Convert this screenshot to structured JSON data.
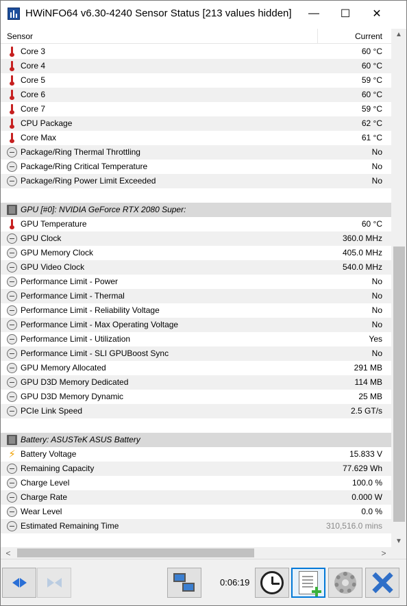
{
  "window": {
    "title": "HWiNFO64 v6.30-4240 Sensor Status [213 values hidden]",
    "minimize_glyph": "—",
    "maximize_glyph": "☐",
    "close_glyph": "✕"
  },
  "header": {
    "sensor": "Sensor",
    "current": "Current"
  },
  "rows": [
    {
      "type": "item",
      "icon": "thermometer-icon",
      "label": "Core 3",
      "value": "60 °C"
    },
    {
      "type": "item",
      "icon": "thermometer-icon",
      "label": "Core 4",
      "value": "60 °C"
    },
    {
      "type": "item",
      "icon": "thermometer-icon",
      "label": "Core 5",
      "value": "59 °C"
    },
    {
      "type": "item",
      "icon": "thermometer-icon",
      "label": "Core 6",
      "value": "60 °C"
    },
    {
      "type": "item",
      "icon": "thermometer-icon",
      "label": "Core 7",
      "value": "59 °C"
    },
    {
      "type": "item",
      "icon": "thermometer-icon",
      "label": "CPU Package",
      "value": "62 °C"
    },
    {
      "type": "item",
      "icon": "thermometer-icon",
      "label": "Core Max",
      "value": "61 °C"
    },
    {
      "type": "item",
      "icon": "gauge-icon",
      "label": "Package/Ring Thermal Throttling",
      "value": "No"
    },
    {
      "type": "item",
      "icon": "gauge-icon",
      "label": "Package/Ring Critical Temperature",
      "value": "No"
    },
    {
      "type": "item",
      "icon": "gauge-icon",
      "label": "Package/Ring Power Limit Exceeded",
      "value": "No"
    },
    {
      "type": "blank",
      "label": "",
      "value": ""
    },
    {
      "type": "group",
      "icon": "chip-icon",
      "label": "GPU [#0]: NVIDIA GeForce RTX 2080 Super:",
      "value": ""
    },
    {
      "type": "item",
      "icon": "thermometer-icon",
      "label": "GPU Temperature",
      "value": "60 °C"
    },
    {
      "type": "item",
      "icon": "gauge-icon",
      "label": "GPU Clock",
      "value": "360.0 MHz"
    },
    {
      "type": "item",
      "icon": "gauge-icon",
      "label": "GPU Memory Clock",
      "value": "405.0 MHz"
    },
    {
      "type": "item",
      "icon": "gauge-icon",
      "label": "GPU Video Clock",
      "value": "540.0 MHz"
    },
    {
      "type": "item",
      "icon": "gauge-icon",
      "label": "Performance Limit - Power",
      "value": "No"
    },
    {
      "type": "item",
      "icon": "gauge-icon",
      "label": "Performance Limit - Thermal",
      "value": "No"
    },
    {
      "type": "item",
      "icon": "gauge-icon",
      "label": "Performance Limit - Reliability Voltage",
      "value": "No"
    },
    {
      "type": "item",
      "icon": "gauge-icon",
      "label": "Performance Limit - Max Operating Voltage",
      "value": "No"
    },
    {
      "type": "item",
      "icon": "gauge-icon",
      "label": "Performance Limit - Utilization",
      "value": "Yes"
    },
    {
      "type": "item",
      "icon": "gauge-icon",
      "label": "Performance Limit - SLI GPUBoost Sync",
      "value": "No"
    },
    {
      "type": "item",
      "icon": "gauge-icon",
      "label": "GPU Memory Allocated",
      "value": "291 MB"
    },
    {
      "type": "item",
      "icon": "gauge-icon",
      "label": "GPU D3D Memory Dedicated",
      "value": "114 MB"
    },
    {
      "type": "item",
      "icon": "gauge-icon",
      "label": "GPU D3D Memory Dynamic",
      "value": "25 MB"
    },
    {
      "type": "item",
      "icon": "gauge-icon",
      "label": "PCIe Link Speed",
      "value": "2.5 GT/s"
    },
    {
      "type": "blank",
      "label": "",
      "value": ""
    },
    {
      "type": "group",
      "icon": "chip-icon",
      "label": "Battery: ASUSTeK ASUS Battery",
      "value": ""
    },
    {
      "type": "item",
      "icon": "lightning-icon",
      "label": "Battery Voltage",
      "value": "15.833 V"
    },
    {
      "type": "item",
      "icon": "gauge-icon",
      "label": "Remaining Capacity",
      "value": "77.629 Wh"
    },
    {
      "type": "item",
      "icon": "gauge-icon",
      "label": "Charge Level",
      "value": "100.0 %"
    },
    {
      "type": "item",
      "icon": "gauge-icon",
      "label": "Charge Rate",
      "value": "0.000 W"
    },
    {
      "type": "item",
      "icon": "gauge-icon",
      "label": "Wear Level",
      "value": "0.0 %"
    },
    {
      "type": "item",
      "icon": "gauge-icon",
      "label": "Estimated Remaining Time",
      "value": "310,516.0 mins",
      "dimmed": true
    }
  ],
  "toolbar": {
    "timer": "0:06:19",
    "buttons": [
      {
        "name": "navigate-arrows-button",
        "icon": "left-right-arrows-icon"
      },
      {
        "name": "navigate-arrows-disabled-button",
        "icon": "collapse-arrows-icon"
      },
      {
        "name": "network-button",
        "icon": "network-computers-icon"
      },
      {
        "name": "reset-clock-button",
        "icon": "clock-icon"
      },
      {
        "name": "logging-button",
        "icon": "document-add-icon"
      },
      {
        "name": "settings-button",
        "icon": "gear-icon"
      },
      {
        "name": "close-sensors-button",
        "icon": "close-x-icon"
      }
    ]
  },
  "scrollbars": {
    "up_glyph": "▲",
    "down_glyph": "▼",
    "left_glyph": "<",
    "right_glyph": ">"
  }
}
